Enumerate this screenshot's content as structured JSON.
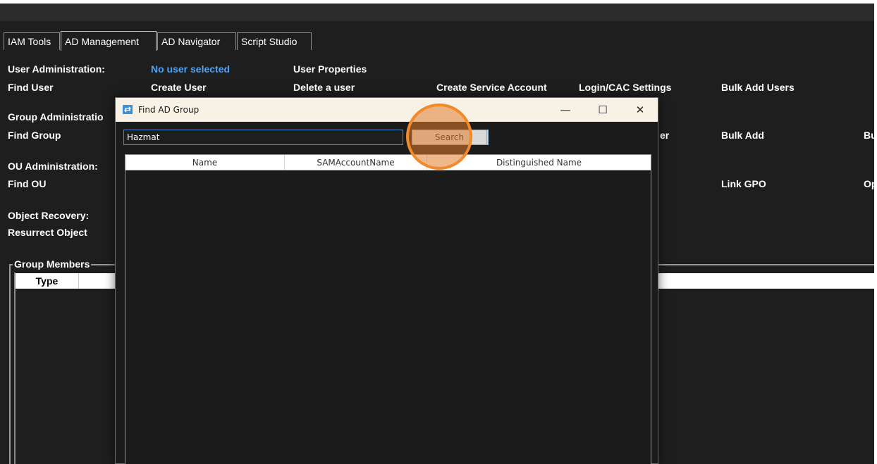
{
  "tabs": [
    {
      "label": "IAM Tools",
      "active": false
    },
    {
      "label": "AD Management",
      "active": true
    },
    {
      "label": "AD Navigator",
      "active": false
    },
    {
      "label": "Script Studio",
      "active": false
    }
  ],
  "user_admin": {
    "heading": "User Administration:",
    "status": "No user selected",
    "properties": "User Properties",
    "find": "Find User",
    "create": "Create User",
    "delete": "Delete a user",
    "service_account": "Create Service Account",
    "login_cac": "Login/CAC Settings",
    "bulk_add_users": "Bulk Add Users"
  },
  "group_admin": {
    "heading": "Group Administratio",
    "find": "Find Group",
    "partial_er": "er",
    "bulk_add": "Bulk Add",
    "partial_bu": "Bu"
  },
  "ou_admin": {
    "heading": "OU Administration:",
    "find": "Find OU",
    "link_gpo": "Link GPO",
    "partial_op": "Op"
  },
  "object_recovery": {
    "heading": "Object Recovery:",
    "resurrect": "Resurrect Object"
  },
  "group_members": {
    "legend": "Group Members",
    "columns": [
      "Type"
    ]
  },
  "dialog": {
    "title": "Find AD Group",
    "minimize_glyph": "—",
    "maximize_glyph": "☐",
    "close_glyph": "✕",
    "search_value": "Hazmat",
    "search_button": "Search",
    "columns": [
      "Name",
      "SAMAccountName",
      "Distinguished Name"
    ]
  },
  "colors": {
    "background": "#1e1e1e",
    "accent_blue": "#4fa3f7",
    "highlight_orange": "#f08a2a",
    "dialog_titlebar": "#f7f1e6"
  }
}
